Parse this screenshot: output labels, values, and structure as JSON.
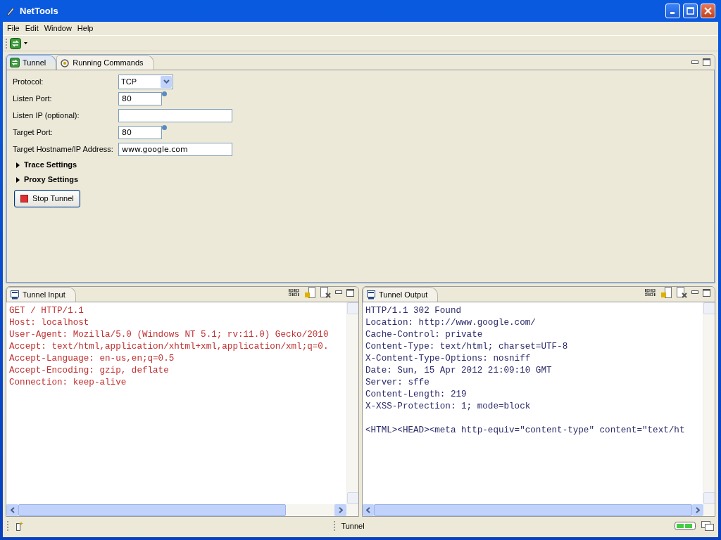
{
  "window": {
    "title": "NetTools"
  },
  "menu": [
    {
      "label": "File"
    },
    {
      "label": "Edit"
    },
    {
      "label": "Window"
    },
    {
      "label": "Help"
    }
  ],
  "tabs": [
    {
      "label": "Tunnel",
      "selected": true
    },
    {
      "label": "Running Commands",
      "selected": false
    }
  ],
  "form": {
    "fields": [
      {
        "kind": "select",
        "label": "Protocol:",
        "value": "TCP"
      },
      {
        "kind": "port",
        "label": "Listen Port:",
        "value": "80"
      },
      {
        "kind": "text",
        "label": "Listen IP (optional):"
      },
      {
        "kind": "port",
        "label": "Target Port:",
        "value": "80"
      },
      {
        "kind": "text",
        "label": "Target Hostname/IP Address:",
        "value": "www.google.com"
      }
    ],
    "sections": [
      {
        "label": "Trace Settings",
        "expanded": false
      },
      {
        "label": "Proxy Settings",
        "expanded": false
      }
    ],
    "button": {
      "label": "Stop Tunnel"
    }
  },
  "panes": [
    {
      "title": "Tunnel Input",
      "kind": "input",
      "blocks": [
        [
          "GET / HTTP/1.1",
          "Host: localhost",
          "User-Agent: Mozilla/5.0 (Windows NT 5.1; rv:11.0) Gecko/2010",
          "Accept: text/html,application/xhtml+xml,application/xml;q=0.",
          "Accept-Language: en-us,en;q=0.5",
          "Accept-Encoding: gzip, deflate",
          "Connection: keep-alive"
        ]
      ]
    },
    {
      "title": "Tunnel Output",
      "kind": "output",
      "blocks": [
        [
          "HTTP/1.1 302 Found",
          "Location: http://www.google.com/",
          "Cache-Control: private",
          "Content-Type: text/html; charset=UTF-8",
          "X-Content-Type-Options: nosniff",
          "Date: Sun, 15 Apr 2012 21:09:10 GMT",
          "Server: sffe",
          "Content-Length: 219",
          "X-XSS-Protection: 1; mode=block"
        ],
        [
          "<HTML><HEAD><meta http-equiv=\"content-type\" content=\"text/ht"
        ]
      ]
    }
  ],
  "status_bar": {
    "perspective": "Tunnel"
  }
}
